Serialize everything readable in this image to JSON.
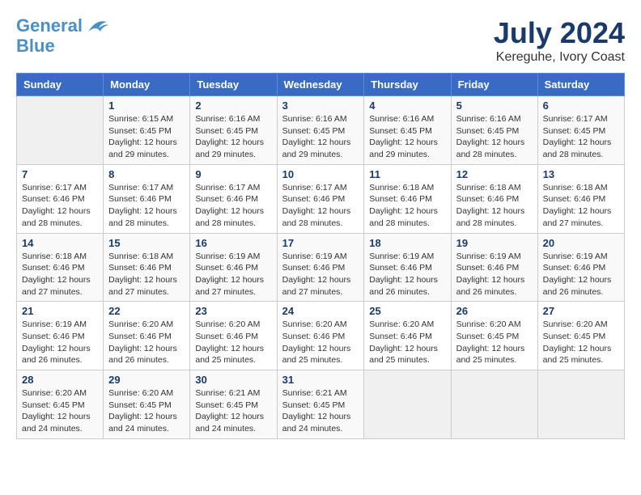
{
  "logo": {
    "line1": "General",
    "line2": "Blue"
  },
  "title": "July 2024",
  "location": "Kereguhe, Ivory Coast",
  "days_of_week": [
    "Sunday",
    "Monday",
    "Tuesday",
    "Wednesday",
    "Thursday",
    "Friday",
    "Saturday"
  ],
  "weeks": [
    [
      {
        "day": "",
        "info": ""
      },
      {
        "day": "1",
        "info": "Sunrise: 6:15 AM\nSunset: 6:45 PM\nDaylight: 12 hours\nand 29 minutes."
      },
      {
        "day": "2",
        "info": "Sunrise: 6:16 AM\nSunset: 6:45 PM\nDaylight: 12 hours\nand 29 minutes."
      },
      {
        "day": "3",
        "info": "Sunrise: 6:16 AM\nSunset: 6:45 PM\nDaylight: 12 hours\nand 29 minutes."
      },
      {
        "day": "4",
        "info": "Sunrise: 6:16 AM\nSunset: 6:45 PM\nDaylight: 12 hours\nand 29 minutes."
      },
      {
        "day": "5",
        "info": "Sunrise: 6:16 AM\nSunset: 6:45 PM\nDaylight: 12 hours\nand 28 minutes."
      },
      {
        "day": "6",
        "info": "Sunrise: 6:17 AM\nSunset: 6:45 PM\nDaylight: 12 hours\nand 28 minutes."
      }
    ],
    [
      {
        "day": "7",
        "info": "Sunrise: 6:17 AM\nSunset: 6:46 PM\nDaylight: 12 hours\nand 28 minutes."
      },
      {
        "day": "8",
        "info": "Sunrise: 6:17 AM\nSunset: 6:46 PM\nDaylight: 12 hours\nand 28 minutes."
      },
      {
        "day": "9",
        "info": "Sunrise: 6:17 AM\nSunset: 6:46 PM\nDaylight: 12 hours\nand 28 minutes."
      },
      {
        "day": "10",
        "info": "Sunrise: 6:17 AM\nSunset: 6:46 PM\nDaylight: 12 hours\nand 28 minutes."
      },
      {
        "day": "11",
        "info": "Sunrise: 6:18 AM\nSunset: 6:46 PM\nDaylight: 12 hours\nand 28 minutes."
      },
      {
        "day": "12",
        "info": "Sunrise: 6:18 AM\nSunset: 6:46 PM\nDaylight: 12 hours\nand 28 minutes."
      },
      {
        "day": "13",
        "info": "Sunrise: 6:18 AM\nSunset: 6:46 PM\nDaylight: 12 hours\nand 27 minutes."
      }
    ],
    [
      {
        "day": "14",
        "info": "Sunrise: 6:18 AM\nSunset: 6:46 PM\nDaylight: 12 hours\nand 27 minutes."
      },
      {
        "day": "15",
        "info": "Sunrise: 6:18 AM\nSunset: 6:46 PM\nDaylight: 12 hours\nand 27 minutes."
      },
      {
        "day": "16",
        "info": "Sunrise: 6:19 AM\nSunset: 6:46 PM\nDaylight: 12 hours\nand 27 minutes."
      },
      {
        "day": "17",
        "info": "Sunrise: 6:19 AM\nSunset: 6:46 PM\nDaylight: 12 hours\nand 27 minutes."
      },
      {
        "day": "18",
        "info": "Sunrise: 6:19 AM\nSunset: 6:46 PM\nDaylight: 12 hours\nand 26 minutes."
      },
      {
        "day": "19",
        "info": "Sunrise: 6:19 AM\nSunset: 6:46 PM\nDaylight: 12 hours\nand 26 minutes."
      },
      {
        "day": "20",
        "info": "Sunrise: 6:19 AM\nSunset: 6:46 PM\nDaylight: 12 hours\nand 26 minutes."
      }
    ],
    [
      {
        "day": "21",
        "info": "Sunrise: 6:19 AM\nSunset: 6:46 PM\nDaylight: 12 hours\nand 26 minutes."
      },
      {
        "day": "22",
        "info": "Sunrise: 6:20 AM\nSunset: 6:46 PM\nDaylight: 12 hours\nand 26 minutes."
      },
      {
        "day": "23",
        "info": "Sunrise: 6:20 AM\nSunset: 6:46 PM\nDaylight: 12 hours\nand 25 minutes."
      },
      {
        "day": "24",
        "info": "Sunrise: 6:20 AM\nSunset: 6:46 PM\nDaylight: 12 hours\nand 25 minutes."
      },
      {
        "day": "25",
        "info": "Sunrise: 6:20 AM\nSunset: 6:46 PM\nDaylight: 12 hours\nand 25 minutes."
      },
      {
        "day": "26",
        "info": "Sunrise: 6:20 AM\nSunset: 6:45 PM\nDaylight: 12 hours\nand 25 minutes."
      },
      {
        "day": "27",
        "info": "Sunrise: 6:20 AM\nSunset: 6:45 PM\nDaylight: 12 hours\nand 25 minutes."
      }
    ],
    [
      {
        "day": "28",
        "info": "Sunrise: 6:20 AM\nSunset: 6:45 PM\nDaylight: 12 hours\nand 24 minutes."
      },
      {
        "day": "29",
        "info": "Sunrise: 6:20 AM\nSunset: 6:45 PM\nDaylight: 12 hours\nand 24 minutes."
      },
      {
        "day": "30",
        "info": "Sunrise: 6:21 AM\nSunset: 6:45 PM\nDaylight: 12 hours\nand 24 minutes."
      },
      {
        "day": "31",
        "info": "Sunrise: 6:21 AM\nSunset: 6:45 PM\nDaylight: 12 hours\nand 24 minutes."
      },
      {
        "day": "",
        "info": ""
      },
      {
        "day": "",
        "info": ""
      },
      {
        "day": "",
        "info": ""
      }
    ]
  ]
}
